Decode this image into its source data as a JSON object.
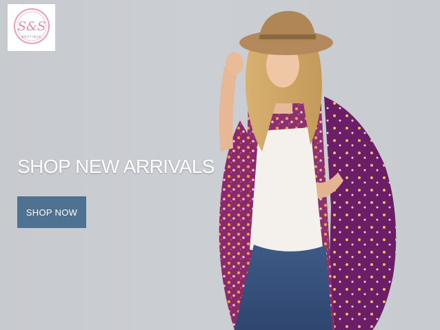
{
  "brand": {
    "logo_text": "S&S",
    "logo_subtext": "BOUTIQUE",
    "logo_color": "#e58aa6"
  },
  "hero": {
    "headline": "SHOP NEW ARRIVALS",
    "cta_label": "SHOP NOW",
    "cta_color": "#4f7290",
    "background_color": "#c9ccd0"
  }
}
